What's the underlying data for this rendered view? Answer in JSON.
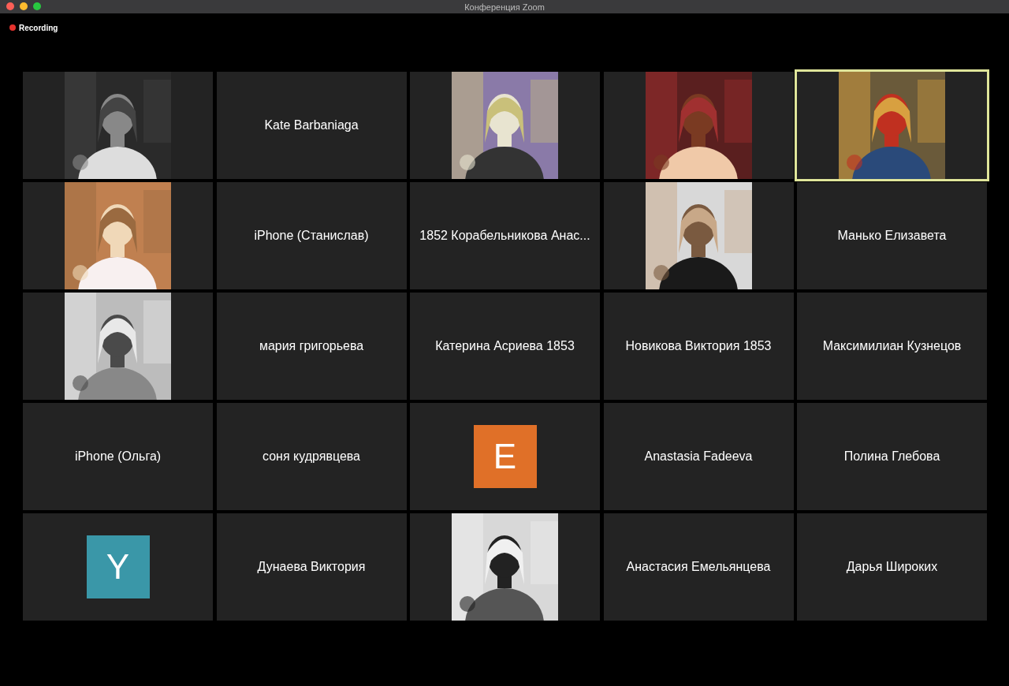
{
  "window": {
    "title": "Конференция Zoom"
  },
  "recording": {
    "label": "Recording",
    "on": true
  },
  "tiles": [
    {
      "kind": "picture",
      "selected": false
    },
    {
      "kind": "name",
      "name": "Kate Barbaniaga",
      "selected": false
    },
    {
      "kind": "picture",
      "selected": false
    },
    {
      "kind": "picture",
      "selected": false
    },
    {
      "kind": "picture",
      "selected": true
    },
    {
      "kind": "picture",
      "selected": false
    },
    {
      "kind": "name",
      "name": "iPhone (Станислав)",
      "selected": false
    },
    {
      "kind": "name",
      "name": "1852 Корабельникова Анас...",
      "selected": false
    },
    {
      "kind": "picture",
      "selected": false
    },
    {
      "kind": "name",
      "name": "Манько Елизавета",
      "selected": false
    },
    {
      "kind": "picture",
      "selected": false
    },
    {
      "kind": "name",
      "name": "мария григорьева",
      "selected": false
    },
    {
      "kind": "name",
      "name": "Катерина Асриева 1853",
      "selected": false
    },
    {
      "kind": "name",
      "name": "Новикова Виктория 1853",
      "selected": false
    },
    {
      "kind": "name",
      "name": "Максимилиан Кузнецов",
      "selected": false
    },
    {
      "kind": "name",
      "name": "iPhone (Ольга)",
      "selected": false
    },
    {
      "kind": "name",
      "name": "соня кудрявцева",
      "selected": false
    },
    {
      "kind": "initial",
      "initial": "E",
      "color": "#e07028",
      "selected": false
    },
    {
      "kind": "name",
      "name": "Anastasia Fadeeva",
      "selected": false
    },
    {
      "kind": "name",
      "name": "Полина Глебова",
      "selected": false
    },
    {
      "kind": "initial",
      "initial": "Y",
      "color": "#3a97a8",
      "selected": false
    },
    {
      "kind": "name",
      "name": "Дунаева Виктория",
      "selected": false
    },
    {
      "kind": "picture",
      "selected": false
    },
    {
      "kind": "name",
      "name": "Анастасия Емельянцева",
      "selected": false
    },
    {
      "kind": "name",
      "name": "Дарья Широких",
      "selected": false
    }
  ]
}
